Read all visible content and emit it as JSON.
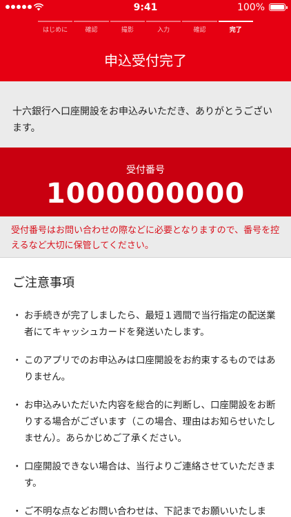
{
  "status_bar": {
    "time": "9:41",
    "battery": "100%",
    "battery_level": 1.0,
    "icons": [
      "signal-dots-icon",
      "wifi-icon",
      "battery-icon"
    ]
  },
  "steps": [
    {
      "label": "はじめに",
      "active": false
    },
    {
      "label": "確認",
      "active": false
    },
    {
      "label": "撮影",
      "active": false
    },
    {
      "label": "入力",
      "active": false
    },
    {
      "label": "確認",
      "active": false
    },
    {
      "label": "完了",
      "active": true
    }
  ],
  "header": {
    "title": "申込受付完了"
  },
  "thanks": {
    "message": "十六銀行へ口座開設をお申込みいただき、ありがとうございます。"
  },
  "receipt": {
    "label": "受付番号",
    "number": "1000000000"
  },
  "warning": {
    "message": "受付番号はお問い合わせの際などに必要となりますので、番号を控えるなど大切に保管してください。"
  },
  "notes": {
    "title": "ご注意事項",
    "bullet": "・",
    "items": [
      "お手続きが完了しましたら、最短１週間で当行指定の配送業者にてキャッシュカードを発送いたします。",
      "このアプリでのお申込みは口座開設をお約束するものではありません。",
      "お申込みいただいた内容を総合的に判断し、口座開設をお断りする場合がございます（この場合、理由はお知らせいたしません）。あらかじめご了承ください。",
      "口座開設できない場合は、当行よりご連絡させていただきます。",
      "ご不明な点などお問い合わせは、下記までお願いいたします。"
    ]
  },
  "colors": {
    "brand_red": "#e60012",
    "dark_red": "#c90010",
    "warning_text": "#d8121d",
    "panel_gray": "#ebebeb"
  }
}
